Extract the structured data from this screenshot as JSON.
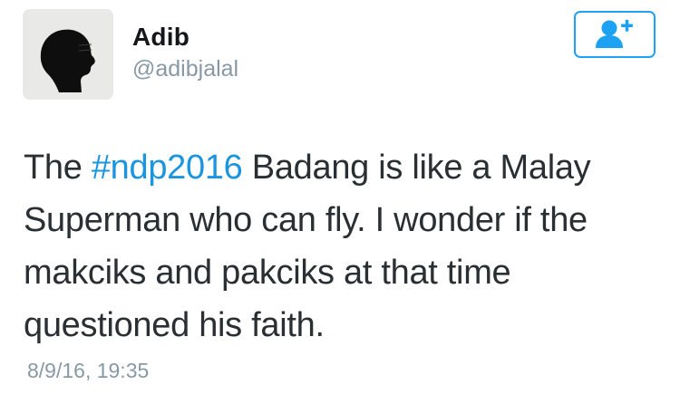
{
  "user": {
    "display_name": "Adib",
    "handle": "@adibjalal"
  },
  "follow_button": {
    "icon": "follow-person-plus-icon",
    "color": "#1da1f2"
  },
  "tweet": {
    "line1_before": "The ",
    "line1_hashtag": "#ndp2016",
    "line1_after": " Badang is like a Malay",
    "line2": "Superman who can fly. I wonder if the",
    "line3": "makciks and pakciks at that time",
    "line4": "questioned his faith.",
    "hashtag_color": "#1b95e0"
  },
  "timestamp": "8/9/16, 19:35"
}
